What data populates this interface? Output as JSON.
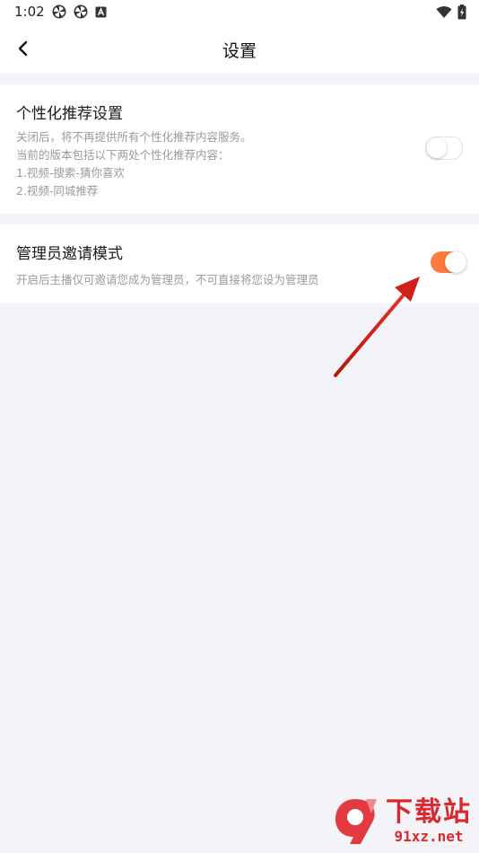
{
  "status_bar": {
    "time": "1:02",
    "left_icons": [
      "pinwheel-icon",
      "pinwheel-icon",
      "app-badge-icon"
    ],
    "right_icons": [
      "wifi-icon",
      "battery-charging-icon"
    ]
  },
  "nav": {
    "title": "设置",
    "back_icon": "chevron-left-icon"
  },
  "settings": [
    {
      "title": "个性化推荐设置",
      "description_lines": [
        "关闭后，将不再提供所有个性化推荐内容服务。",
        "当前的版本包括以下两处个性化推荐内容：",
        "1.视频-搜索-猜你喜欢",
        "2.视频-同城推荐"
      ],
      "enabled": false
    },
    {
      "title": "管理员邀请模式",
      "description_lines": [
        "开启后主播仅可邀请您成为管理员，不可直接将您设为管理员"
      ],
      "enabled": true
    }
  ],
  "watermark": {
    "logo_text": "9",
    "main": "下载站",
    "sub": "91xz.net"
  },
  "colors": {
    "accent": "#ff7a3d",
    "background": "#f4f4f8",
    "annotation_arrow": "#d0201c",
    "watermark": "#d8292e"
  }
}
